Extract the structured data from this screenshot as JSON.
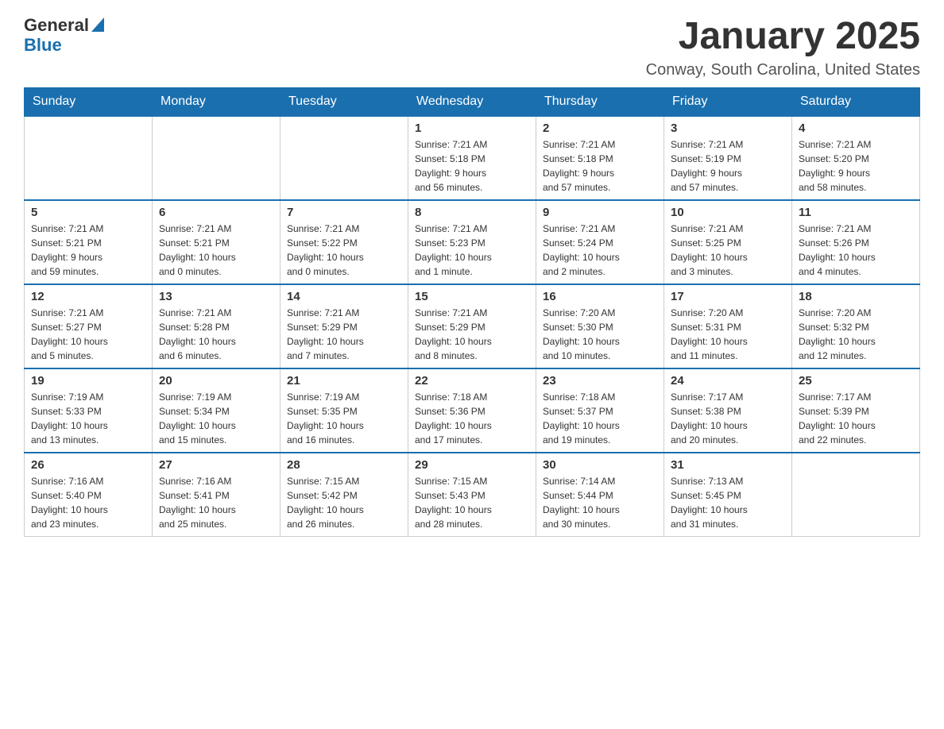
{
  "header": {
    "logo_general": "General",
    "logo_blue": "Blue",
    "month_year": "January 2025",
    "location": "Conway, South Carolina, United States"
  },
  "days_of_week": [
    "Sunday",
    "Monday",
    "Tuesday",
    "Wednesday",
    "Thursday",
    "Friday",
    "Saturday"
  ],
  "weeks": [
    [
      {
        "day": "",
        "info": ""
      },
      {
        "day": "",
        "info": ""
      },
      {
        "day": "",
        "info": ""
      },
      {
        "day": "1",
        "info": "Sunrise: 7:21 AM\nSunset: 5:18 PM\nDaylight: 9 hours\nand 56 minutes."
      },
      {
        "day": "2",
        "info": "Sunrise: 7:21 AM\nSunset: 5:18 PM\nDaylight: 9 hours\nand 57 minutes."
      },
      {
        "day": "3",
        "info": "Sunrise: 7:21 AM\nSunset: 5:19 PM\nDaylight: 9 hours\nand 57 minutes."
      },
      {
        "day": "4",
        "info": "Sunrise: 7:21 AM\nSunset: 5:20 PM\nDaylight: 9 hours\nand 58 minutes."
      }
    ],
    [
      {
        "day": "5",
        "info": "Sunrise: 7:21 AM\nSunset: 5:21 PM\nDaylight: 9 hours\nand 59 minutes."
      },
      {
        "day": "6",
        "info": "Sunrise: 7:21 AM\nSunset: 5:21 PM\nDaylight: 10 hours\nand 0 minutes."
      },
      {
        "day": "7",
        "info": "Sunrise: 7:21 AM\nSunset: 5:22 PM\nDaylight: 10 hours\nand 0 minutes."
      },
      {
        "day": "8",
        "info": "Sunrise: 7:21 AM\nSunset: 5:23 PM\nDaylight: 10 hours\nand 1 minute."
      },
      {
        "day": "9",
        "info": "Sunrise: 7:21 AM\nSunset: 5:24 PM\nDaylight: 10 hours\nand 2 minutes."
      },
      {
        "day": "10",
        "info": "Sunrise: 7:21 AM\nSunset: 5:25 PM\nDaylight: 10 hours\nand 3 minutes."
      },
      {
        "day": "11",
        "info": "Sunrise: 7:21 AM\nSunset: 5:26 PM\nDaylight: 10 hours\nand 4 minutes."
      }
    ],
    [
      {
        "day": "12",
        "info": "Sunrise: 7:21 AM\nSunset: 5:27 PM\nDaylight: 10 hours\nand 5 minutes."
      },
      {
        "day": "13",
        "info": "Sunrise: 7:21 AM\nSunset: 5:28 PM\nDaylight: 10 hours\nand 6 minutes."
      },
      {
        "day": "14",
        "info": "Sunrise: 7:21 AM\nSunset: 5:29 PM\nDaylight: 10 hours\nand 7 minutes."
      },
      {
        "day": "15",
        "info": "Sunrise: 7:21 AM\nSunset: 5:29 PM\nDaylight: 10 hours\nand 8 minutes."
      },
      {
        "day": "16",
        "info": "Sunrise: 7:20 AM\nSunset: 5:30 PM\nDaylight: 10 hours\nand 10 minutes."
      },
      {
        "day": "17",
        "info": "Sunrise: 7:20 AM\nSunset: 5:31 PM\nDaylight: 10 hours\nand 11 minutes."
      },
      {
        "day": "18",
        "info": "Sunrise: 7:20 AM\nSunset: 5:32 PM\nDaylight: 10 hours\nand 12 minutes."
      }
    ],
    [
      {
        "day": "19",
        "info": "Sunrise: 7:19 AM\nSunset: 5:33 PM\nDaylight: 10 hours\nand 13 minutes."
      },
      {
        "day": "20",
        "info": "Sunrise: 7:19 AM\nSunset: 5:34 PM\nDaylight: 10 hours\nand 15 minutes."
      },
      {
        "day": "21",
        "info": "Sunrise: 7:19 AM\nSunset: 5:35 PM\nDaylight: 10 hours\nand 16 minutes."
      },
      {
        "day": "22",
        "info": "Sunrise: 7:18 AM\nSunset: 5:36 PM\nDaylight: 10 hours\nand 17 minutes."
      },
      {
        "day": "23",
        "info": "Sunrise: 7:18 AM\nSunset: 5:37 PM\nDaylight: 10 hours\nand 19 minutes."
      },
      {
        "day": "24",
        "info": "Sunrise: 7:17 AM\nSunset: 5:38 PM\nDaylight: 10 hours\nand 20 minutes."
      },
      {
        "day": "25",
        "info": "Sunrise: 7:17 AM\nSunset: 5:39 PM\nDaylight: 10 hours\nand 22 minutes."
      }
    ],
    [
      {
        "day": "26",
        "info": "Sunrise: 7:16 AM\nSunset: 5:40 PM\nDaylight: 10 hours\nand 23 minutes."
      },
      {
        "day": "27",
        "info": "Sunrise: 7:16 AM\nSunset: 5:41 PM\nDaylight: 10 hours\nand 25 minutes."
      },
      {
        "day": "28",
        "info": "Sunrise: 7:15 AM\nSunset: 5:42 PM\nDaylight: 10 hours\nand 26 minutes."
      },
      {
        "day": "29",
        "info": "Sunrise: 7:15 AM\nSunset: 5:43 PM\nDaylight: 10 hours\nand 28 minutes."
      },
      {
        "day": "30",
        "info": "Sunrise: 7:14 AM\nSunset: 5:44 PM\nDaylight: 10 hours\nand 30 minutes."
      },
      {
        "day": "31",
        "info": "Sunrise: 7:13 AM\nSunset: 5:45 PM\nDaylight: 10 hours\nand 31 minutes."
      },
      {
        "day": "",
        "info": ""
      }
    ]
  ]
}
